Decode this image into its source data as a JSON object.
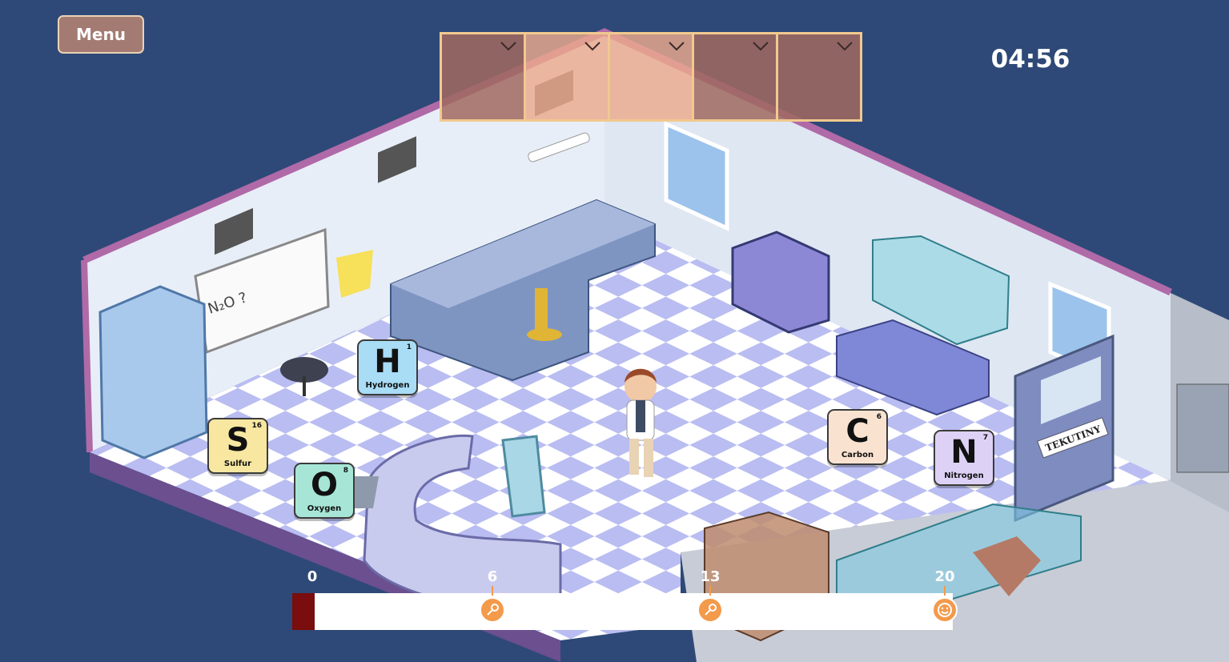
{
  "menu": {
    "label": "Menu"
  },
  "timer": {
    "value": "04:56"
  },
  "answer_slots": [
    {
      "id": 1,
      "state": "empty"
    },
    {
      "id": 2,
      "state": "empty"
    },
    {
      "id": 3,
      "state": "empty"
    },
    {
      "id": 4,
      "state": "empty"
    },
    {
      "id": 5,
      "state": "empty"
    }
  ],
  "elements": [
    {
      "symbol": "H",
      "number": "1",
      "name": "Hydrogen",
      "color": "#a9dcf5"
    },
    {
      "symbol": "S",
      "number": "16",
      "name": "Sulfur",
      "color": "#f7e7a1"
    },
    {
      "symbol": "O",
      "number": "8",
      "name": "Oxygen",
      "color": "#a7e6d6"
    },
    {
      "symbol": "C",
      "number": "6",
      "name": "Carbon",
      "color": "#f9e3d0"
    },
    {
      "symbol": "N",
      "number": "7",
      "name": "Nitrogen",
      "color": "#ddd2f5"
    }
  ],
  "room": {
    "door_sign": "TEKUTINY",
    "whiteboard_text": "N₂O ?"
  },
  "progress": {
    "current": 0,
    "max": 20,
    "fill_color": "#7a0d0d",
    "milestones": [
      {
        "value": "0",
        "icon": "none"
      },
      {
        "value": "6",
        "icon": "key-icon"
      },
      {
        "value": "13",
        "icon": "key-icon"
      },
      {
        "value": "20",
        "icon": "smiley-icon"
      }
    ]
  }
}
